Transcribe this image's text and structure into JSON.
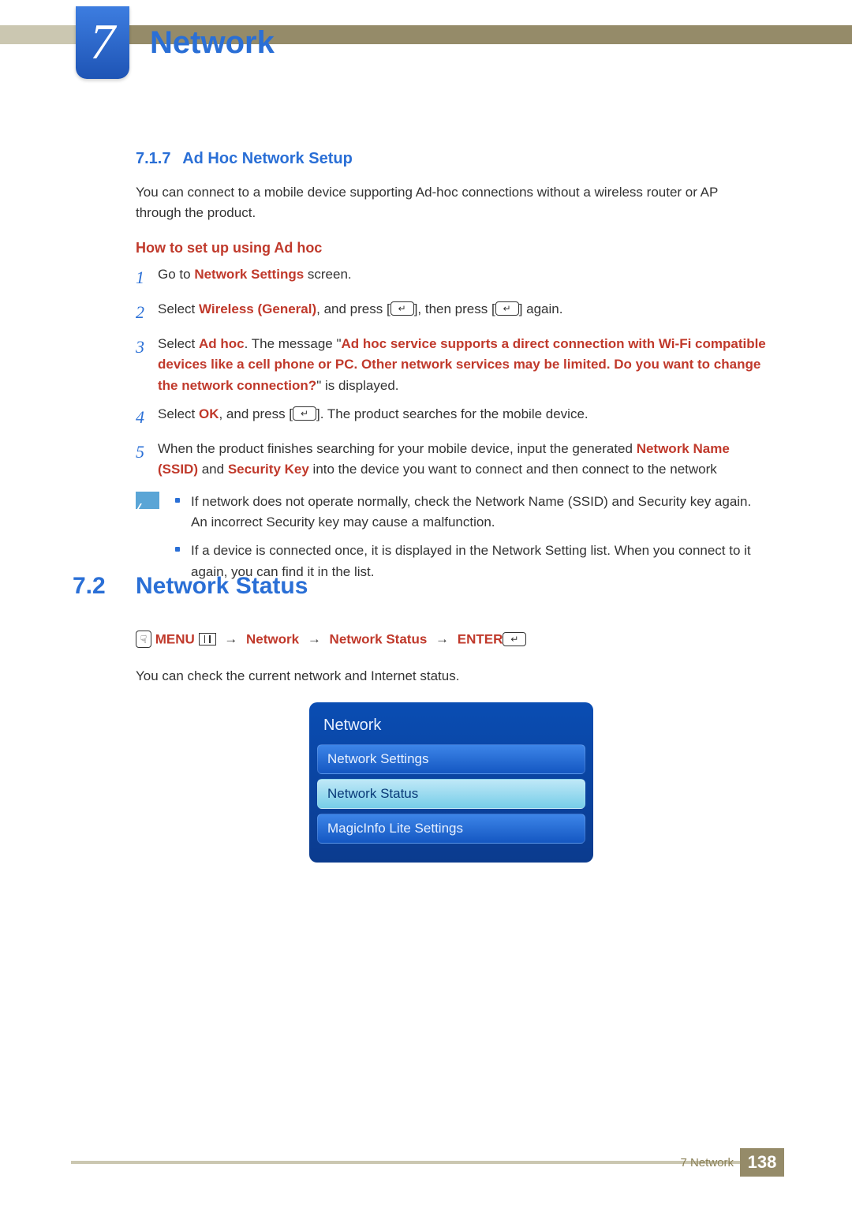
{
  "header": {
    "chapter_number": "7",
    "chapter_title": "Network"
  },
  "section_717": {
    "number": "7.1.7",
    "title": "Ad Hoc Network Setup",
    "intro": "You can connect to a mobile device supporting Ad-hoc connections without a wireless router or AP through the product.",
    "howto_heading": "How to set up using Ad hoc",
    "steps": {
      "n1": "1",
      "s1_a": "Go to ",
      "s1_b": "Network Settings",
      "s1_c": " screen.",
      "n2": "2",
      "s2_a": "Select ",
      "s2_b": "Wireless (General)",
      "s2_c": ", and press [",
      "s2_d": "], then press [",
      "s2_e": "] again.",
      "n3": "3",
      "s3_a": "Select ",
      "s3_b": "Ad hoc",
      "s3_c": ". The message \"",
      "s3_d": "Ad hoc service supports a direct connection with Wi-Fi compatible devices like a cell phone or PC. Other network services may be limited. Do you want to change the network connection?",
      "s3_e": "\" is displayed.",
      "n4": "4",
      "s4_a": "Select ",
      "s4_b": "OK",
      "s4_c": ", and press [",
      "s4_d": "]. The product searches for the mobile device.",
      "n5": "5",
      "s5_a": "When the product finishes searching for your mobile device, input the generated ",
      "s5_b": "Network Name (SSID)",
      "s5_c": " and ",
      "s5_d": "Security Key",
      "s5_e": " into the device you want to connect and then connect to the network"
    },
    "notes": {
      "b1": "If network does not operate normally, check the Network Name (SSID) and Security key again. An incorrect Security key may cause a malfunction.",
      "b2": "If a device is connected once, it is displayed in the Network Setting list. When you connect to it again, you can find it in the list."
    }
  },
  "section_72": {
    "number": "7.2",
    "title": "Network Status",
    "breadcrumb": {
      "menu": "MENU",
      "arrow": "→",
      "p1": "Network",
      "p2": "Network Status",
      "enter": "ENTER"
    },
    "desc": "You can check the current network and Internet status.",
    "menu": {
      "title": "Network",
      "items": [
        "Network Settings",
        "Network Status",
        "MagicInfo Lite Settings"
      ],
      "selected_index": 1
    }
  },
  "footer": {
    "label": "7  Network",
    "page": "138"
  },
  "icons": {
    "enter_glyph": "↵",
    "hand_glyph": "☟"
  }
}
